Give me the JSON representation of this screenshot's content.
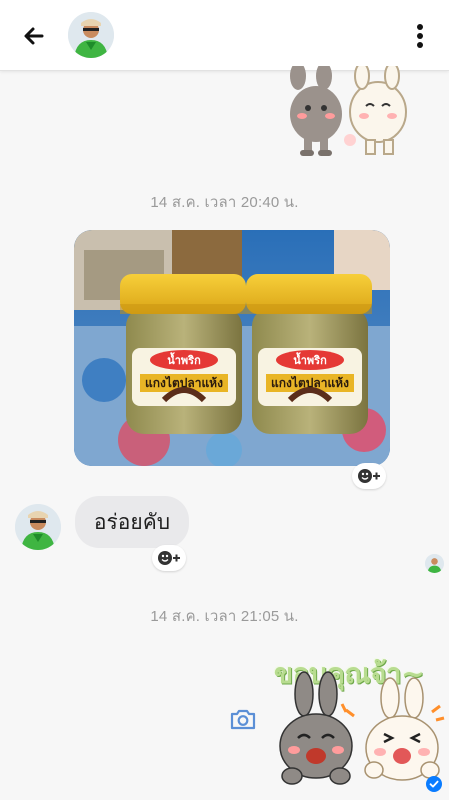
{
  "header": {
    "back_icon": "arrow-left-icon",
    "avatar": "contact-avatar",
    "menu_icon": "more-vertical-icon"
  },
  "conversation": {
    "timestamp_1": "14 ส.ค. เวลา 20:40 น.",
    "photo": {
      "jar_brand": "น้ำพริก",
      "jar_product": "แกงไตปลาแห้ง"
    },
    "message_text": "อร่อยคับ",
    "timestamp_2": "14 ส.ค. เวลา 21:05 น.",
    "sticker_text": "ขอบคุณจ้า~",
    "react_icon": "add-reaction-icon",
    "camera_icon": "camera-icon",
    "sent_icon": "check-circle-icon"
  },
  "colors": {
    "accent": "#0a7cff",
    "bubble": "#e9e9eb",
    "timestamp": "#9a9a9a"
  }
}
